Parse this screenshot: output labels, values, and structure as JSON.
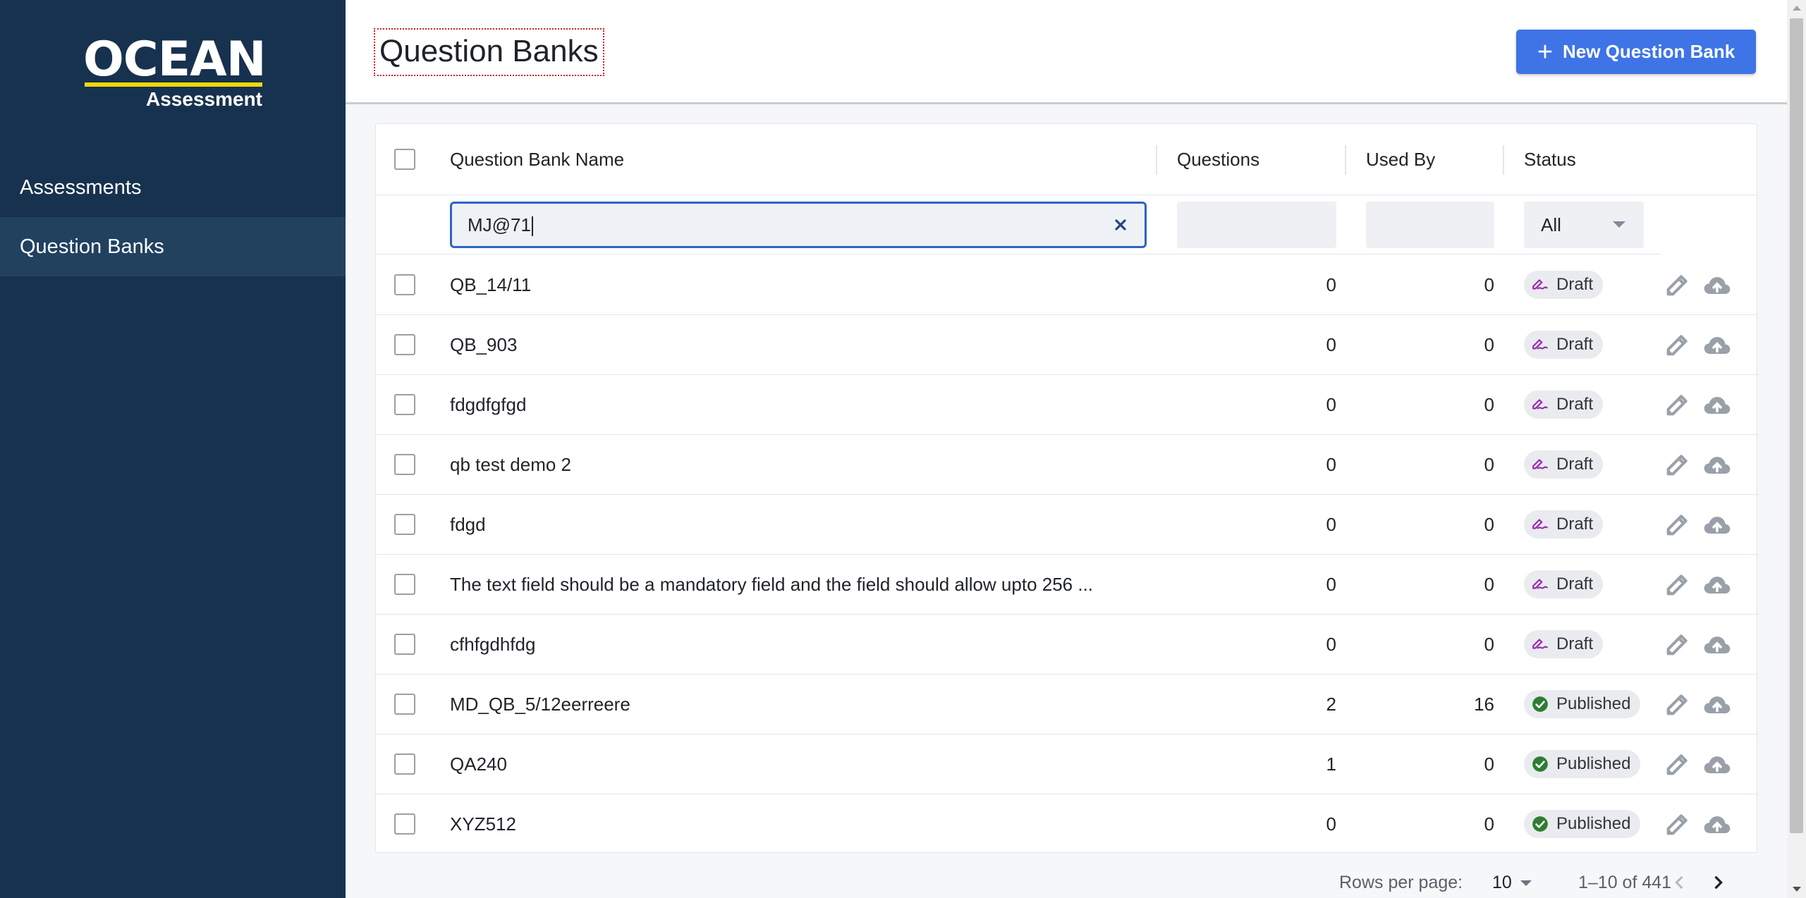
{
  "brand": {
    "logo_main": "OCEAN",
    "logo_sub": "Assessment",
    "accent_color": "#f5d90a"
  },
  "sidebar": {
    "items": [
      {
        "label": "Assessments",
        "active": false
      },
      {
        "label": "Question Banks",
        "active": true
      }
    ]
  },
  "header": {
    "title": "Question Banks",
    "new_button_label": "New Question Bank",
    "new_button_icon": "plus-icon"
  },
  "table": {
    "columns": [
      "Question Bank Name",
      "Questions",
      "Used By",
      "Status"
    ],
    "filters": {
      "name_value": "MJ@71",
      "questions_value": "",
      "used_by_value": "",
      "status_value": "All"
    },
    "rows": [
      {
        "name": "QB_14/11",
        "questions": "0",
        "used_by": "0",
        "status": "Draft"
      },
      {
        "name": "QB_903",
        "questions": "0",
        "used_by": "0",
        "status": "Draft"
      },
      {
        "name": "fdgdfgfgd",
        "questions": "0",
        "used_by": "0",
        "status": "Draft"
      },
      {
        "name": "qb test demo 2",
        "questions": "0",
        "used_by": "0",
        "status": "Draft"
      },
      {
        "name": "fdgd",
        "questions": "0",
        "used_by": "0",
        "status": "Draft"
      },
      {
        "name": "The text field should be a mandatory field and the field should allow upto 256 ...",
        "questions": "0",
        "used_by": "0",
        "status": "Draft"
      },
      {
        "name": "cfhfgdhfdg",
        "questions": "0",
        "used_by": "0",
        "status": "Draft"
      },
      {
        "name": "MD_QB_5/12eerreere",
        "questions": "2",
        "used_by": "16",
        "status": "Published"
      },
      {
        "name": "QA240",
        "questions": "1",
        "used_by": "0",
        "status": "Published"
      },
      {
        "name": "XYZ512",
        "questions": "0",
        "used_by": "0",
        "status": "Published"
      }
    ],
    "status_colors": {
      "Draft": "#9c27b0",
      "Published": "#2e7d32"
    }
  },
  "pagination": {
    "rows_per_page_label": "Rows per page:",
    "rows_per_page": "10",
    "range": "1–10 of 441"
  }
}
